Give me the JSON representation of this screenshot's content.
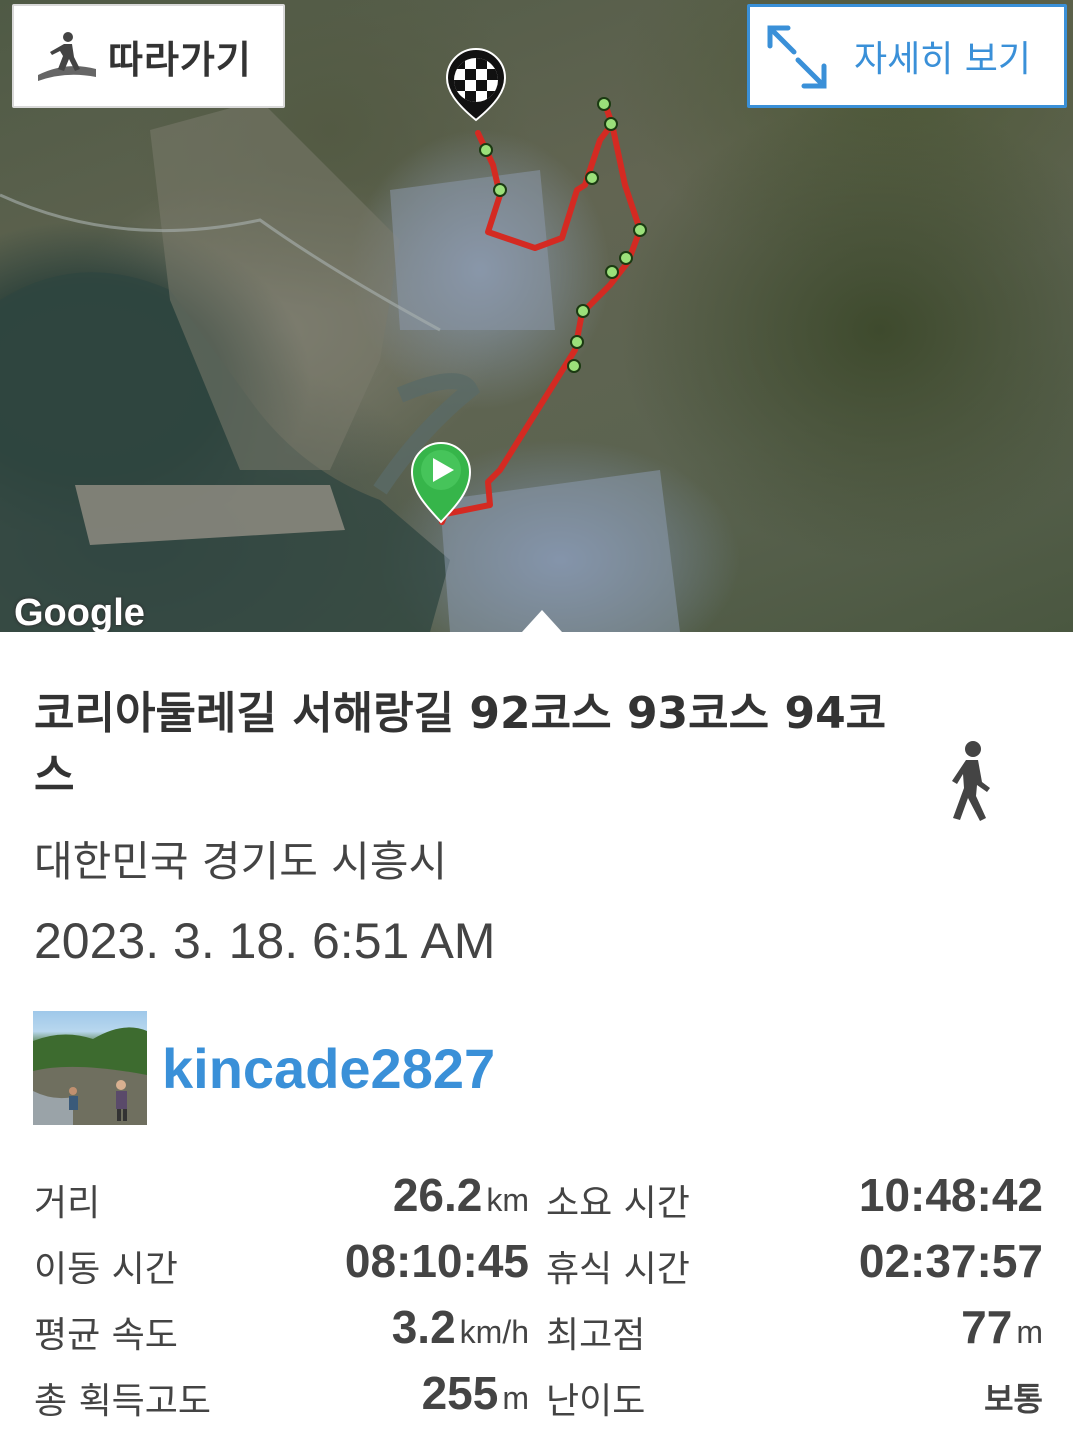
{
  "map": {
    "follow_label": "따라가기",
    "detail_label": "자세히 보기",
    "attribution": "Google"
  },
  "trail": {
    "title": "코리아둘레길 서해랑길 92코스 93코스 94코스",
    "location": "대한민국 경기도 시흥시",
    "datetime": "2023. 3. 18. 6:51 AM",
    "activity_icon": "walking-person-icon"
  },
  "user": {
    "username": "kincade2827"
  },
  "stats": {
    "distance_label": "거리",
    "distance_value": "26.2",
    "distance_unit": "km",
    "total_time_label": "소요 시간",
    "total_time_value": "10:48:42",
    "moving_time_label": "이동 시간",
    "moving_time_value": "08:10:45",
    "rest_time_label": "휴식 시간",
    "rest_time_value": "02:37:57",
    "avg_speed_label": "평균 속도",
    "avg_speed_value": "3.2",
    "avg_speed_unit": "km/h",
    "max_alt_label": "최고점",
    "max_alt_value": "77",
    "max_alt_unit": "m",
    "total_ascent_label": "총 획득고도",
    "total_ascent_value": "255",
    "total_ascent_unit": "m",
    "difficulty_label": "난이도",
    "difficulty_value": "보통"
  },
  "colors": {
    "accent": "#3a90d8",
    "route": "#d42a22",
    "start_marker": "#36b54a",
    "waypoint": "#9be07a"
  }
}
